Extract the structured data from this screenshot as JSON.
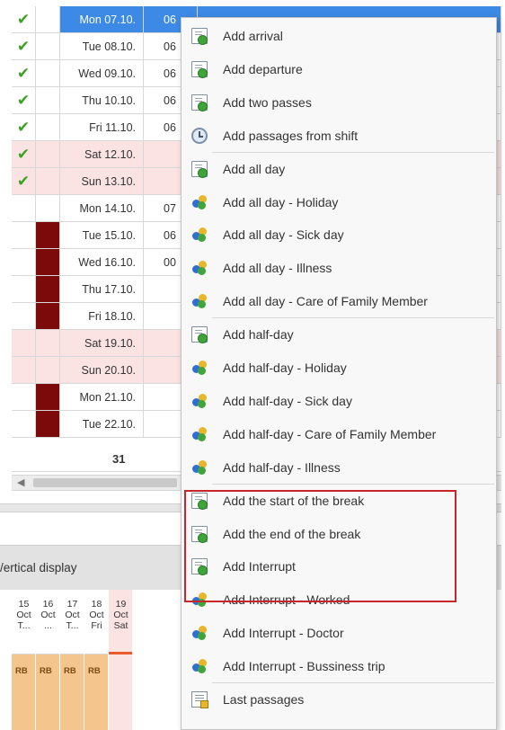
{
  "grid": {
    "rows": [
      {
        "date": "Mon 07.10.",
        "time": "06",
        "check": true,
        "flag": false,
        "weekend": false,
        "selected": true
      },
      {
        "date": "Tue 08.10.",
        "time": "06",
        "check": true,
        "flag": false,
        "weekend": false,
        "selected": false
      },
      {
        "date": "Wed 09.10.",
        "time": "06",
        "check": true,
        "flag": false,
        "weekend": false,
        "selected": false
      },
      {
        "date": "Thu 10.10.",
        "time": "06",
        "check": true,
        "flag": false,
        "weekend": false,
        "selected": false
      },
      {
        "date": "Fri 11.10.",
        "time": "06",
        "check": true,
        "flag": false,
        "weekend": false,
        "selected": false
      },
      {
        "date": "Sat 12.10.",
        "time": "",
        "check": true,
        "flag": false,
        "weekend": true,
        "selected": false
      },
      {
        "date": "Sun 13.10.",
        "time": "",
        "check": true,
        "flag": false,
        "weekend": true,
        "selected": false
      },
      {
        "date": "Mon 14.10.",
        "time": "07",
        "check": false,
        "flag": false,
        "weekend": false,
        "selected": false
      },
      {
        "date": "Tue 15.10.",
        "time": "06",
        "check": false,
        "flag": true,
        "weekend": false,
        "selected": false
      },
      {
        "date": "Wed 16.10.",
        "time": "00",
        "check": false,
        "flag": true,
        "weekend": false,
        "selected": false
      },
      {
        "date": "Thu 17.10.",
        "time": "",
        "check": false,
        "flag": true,
        "weekend": false,
        "selected": false
      },
      {
        "date": "Fri 18.10.",
        "time": "",
        "check": false,
        "flag": true,
        "weekend": false,
        "selected": false
      },
      {
        "date": "Sat 19.10.",
        "time": "",
        "check": false,
        "flag": false,
        "weekend": true,
        "selected": false
      },
      {
        "date": "Sun 20.10.",
        "time": "",
        "check": false,
        "flag": false,
        "weekend": true,
        "selected": false
      },
      {
        "date": "Mon 21.10.",
        "time": "",
        "check": false,
        "flag": true,
        "weekend": false,
        "selected": false
      },
      {
        "date": "Tue 22.10.",
        "time": "",
        "check": false,
        "flag": true,
        "weekend": false,
        "selected": false
      }
    ],
    "total": "31"
  },
  "vertical_display": {
    "label": "/ertical display"
  },
  "days": [
    {
      "l1": "15",
      "l2": "Oct",
      "l3": "T...",
      "code": "RB",
      "sat": false
    },
    {
      "l1": "16",
      "l2": "Oct",
      "l3": "...",
      "code": "RB",
      "sat": false
    },
    {
      "l1": "17",
      "l2": "Oct",
      "l3": "T...",
      "code": "RB",
      "sat": false
    },
    {
      "l1": "18",
      "l2": "Oct",
      "l3": "Fri",
      "code": "RB",
      "sat": false
    },
    {
      "l1": "19",
      "l2": "Oct",
      "l3": "Sat",
      "code": "",
      "sat": true
    }
  ],
  "menu": {
    "groups": [
      [
        {
          "label": "Add arrival",
          "icon": "doc-add-icon"
        },
        {
          "label": "Add departure",
          "icon": "doc-add-icon"
        },
        {
          "label": "Add two passes",
          "icon": "doc-add-icon"
        },
        {
          "label": "Add passages from shift",
          "icon": "clock-icon"
        }
      ],
      [
        {
          "label": "Add all day",
          "icon": "doc-add-icon"
        },
        {
          "label": "Add all day - Holiday",
          "icon": "people-icon"
        },
        {
          "label": "Add all day - Sick day",
          "icon": "people-icon"
        },
        {
          "label": "Add all day - Illness",
          "icon": "people-icon"
        },
        {
          "label": "Add all day - Care of Family Member",
          "icon": "people-icon"
        }
      ],
      [
        {
          "label": "Add half-day",
          "icon": "doc-add-icon"
        },
        {
          "label": "Add half-day - Holiday",
          "icon": "people-icon"
        },
        {
          "label": "Add half-day - Sick day",
          "icon": "people-icon"
        },
        {
          "label": "Add half-day - Care of Family Member",
          "icon": "people-icon"
        },
        {
          "label": "Add half-day - Illness",
          "icon": "people-icon"
        }
      ],
      [
        {
          "label": "Add the start of the break",
          "icon": "doc-add-icon"
        },
        {
          "label": "Add the end of the break",
          "icon": "doc-add-icon"
        },
        {
          "label": "Add Interrupt",
          "icon": "doc-add-icon"
        },
        {
          "label": "Add Interrupt - Worked",
          "icon": "people-icon"
        },
        {
          "label": "Add Interrupt - Doctor",
          "icon": "people-icon"
        },
        {
          "label": "Add Interrupt - Bussiness trip",
          "icon": "people-icon"
        }
      ],
      [
        {
          "label": "Last passages",
          "icon": "list-icon"
        }
      ]
    ]
  },
  "colors": {
    "selected_row": "#3d8ae6",
    "weekend_row": "#fbe3e3",
    "flag_dark": "#7d0a0a",
    "check_green": "#3aa321",
    "highlight_red": "#c8262b",
    "day_body": "#f5c58e"
  }
}
